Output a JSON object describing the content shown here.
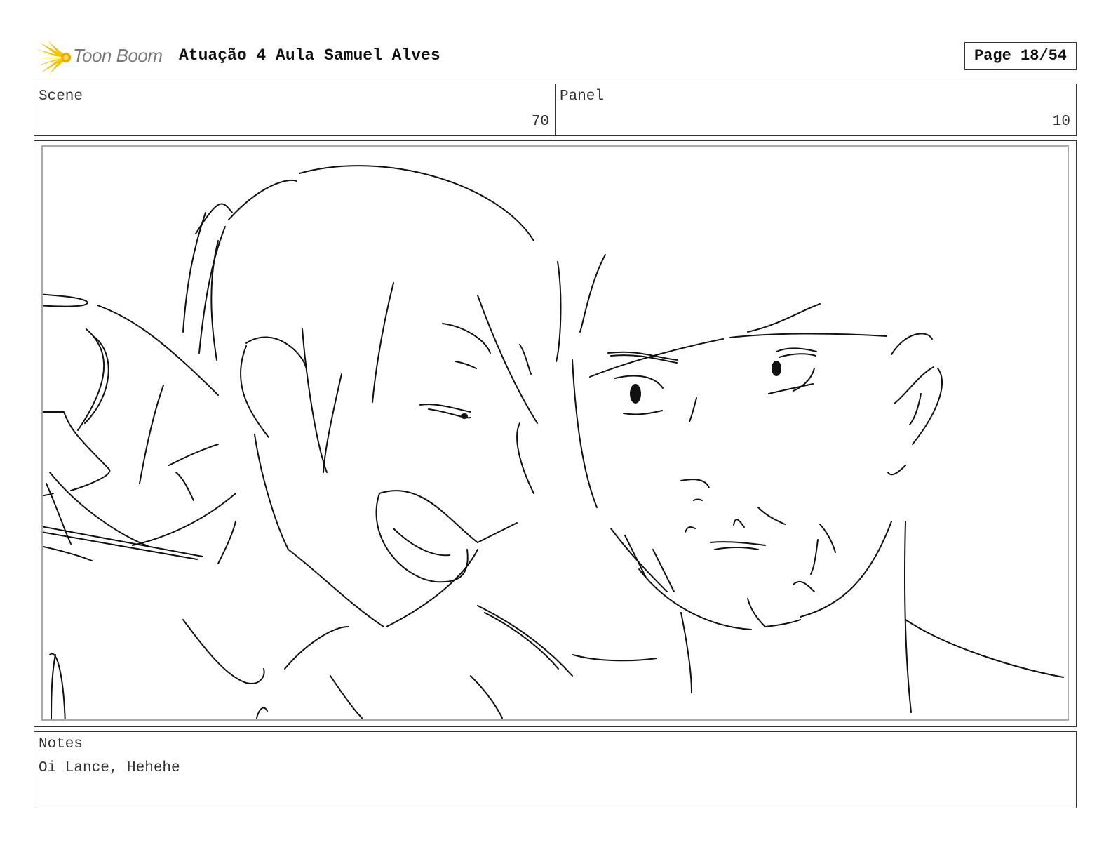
{
  "header": {
    "logo_text": "Toon Boom",
    "title": "Atuação 4 Aula Samuel Alves",
    "page": "Page 18/54"
  },
  "meta": {
    "scene_label": "Scene",
    "scene_value": "70",
    "panel_label": "Panel",
    "panel_value": "10"
  },
  "notes": {
    "label": "Notes",
    "text": "Oi Lance, Hehehe"
  },
  "colors": {
    "logo_accent": "#f5c400",
    "ink": "#111111"
  }
}
